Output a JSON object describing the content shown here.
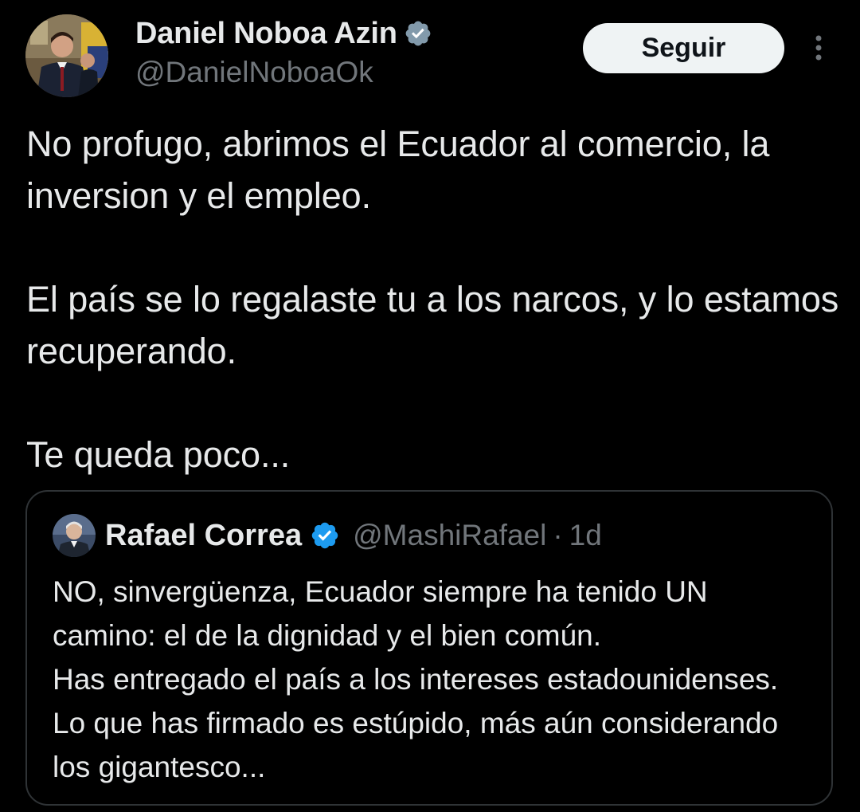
{
  "author": {
    "display_name": "Daniel Noboa Azin",
    "handle": "@DanielNoboaOk",
    "verified": true,
    "avatar_icon": "profile-photo"
  },
  "actions": {
    "follow_label": "Seguir",
    "more_icon": "more-vertical-icon"
  },
  "tweet": {
    "paragraphs": [
      "No profugo, abrimos el Ecuador al comercio, la inversion y el empleo.",
      "El país se lo regalaste tu a los narcos, y lo estamos recuperando.",
      "Te queda poco..."
    ]
  },
  "quoted_tweet": {
    "display_name": "Rafael Correa",
    "handle": "@MashiRafael",
    "separator": "·",
    "time": "1d",
    "verified": true,
    "text": "NO, sinvergüenza, Ecuador siempre ha tenido UN camino: el de la dignidad y el bien común.\nHas entregado el país a los intereses estadounidenses. Lo que has firmado es estúpido, más aún considerando los gigantesco..."
  },
  "colors": {
    "background": "#000000",
    "text_primary": "#e7e9ea",
    "text_secondary": "#71767b",
    "verified_badge_author": "#829aab",
    "verified_badge_quote": "#1d9bf0",
    "follow_button_bg": "#eff3f4",
    "border": "#2f3336"
  }
}
